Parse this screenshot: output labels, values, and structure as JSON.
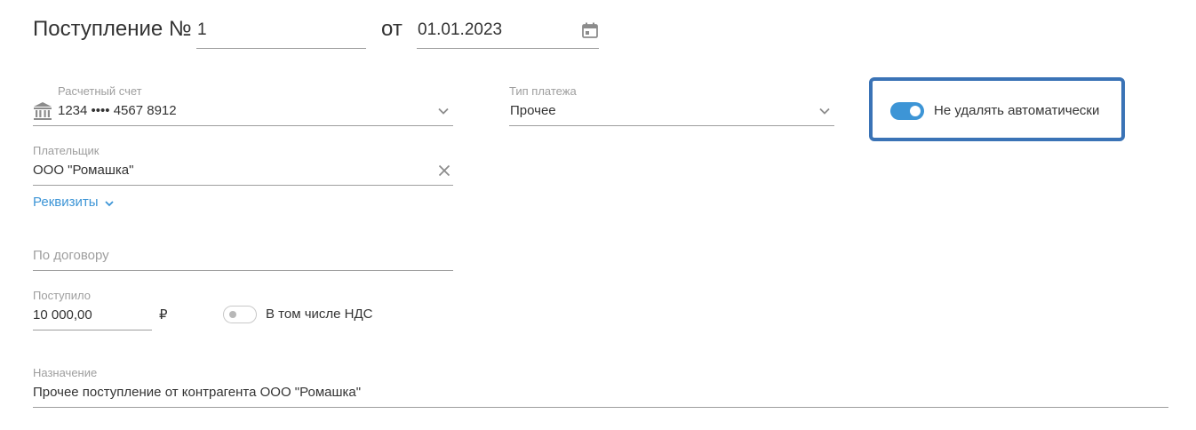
{
  "header": {
    "title": "Поступление №",
    "number": "1",
    "date_separator": "от",
    "date": "01.01.2023"
  },
  "account": {
    "label": "Расчетный счет",
    "value": "1234 •••• 4567 8912"
  },
  "payment_type": {
    "label": "Тип платежа",
    "value": "Прочее"
  },
  "keep_toggle": {
    "label": "Не удалять автоматически",
    "checked": true
  },
  "payer": {
    "label": "Плательщик",
    "value": "ООО \"Ромашка\""
  },
  "requisites_link": "Реквизиты",
  "contract": {
    "placeholder": "По договору"
  },
  "amount": {
    "label": "Поступило",
    "value": "10 000,00",
    "currency": "₽"
  },
  "vat_toggle": {
    "label": "В том числе НДС",
    "checked": false
  },
  "purpose": {
    "label": "Назначение",
    "value": "Прочее поступление от контрагента ООО \"Ромашка\""
  },
  "colors": {
    "accent": "#3d95d6",
    "highlight_border": "#3a73b6",
    "label_gray": "#9e9e9e",
    "text": "#333333"
  },
  "icons": {
    "date": "calendar-icon",
    "account": "bank-icon",
    "select": "chevron-down-icon",
    "clear": "close-icon"
  }
}
